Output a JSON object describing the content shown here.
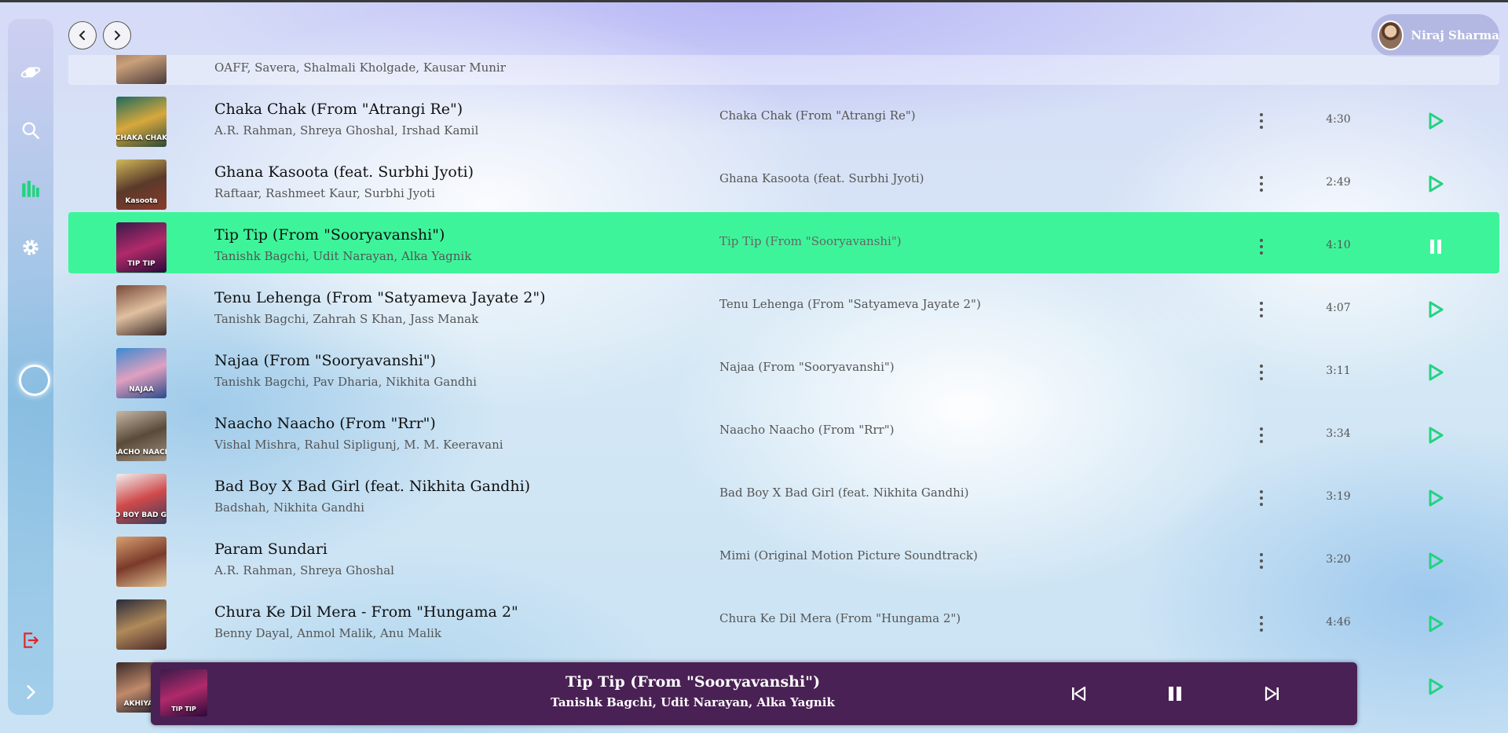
{
  "user": {
    "name": "Niraj Sharma"
  },
  "colors": {
    "accent": "#3ef49a",
    "player_bg": "#4a2154",
    "play_icon": "#22d37f",
    "logout_icon": "#e02424"
  },
  "sidebar": {
    "items": [
      {
        "icon": "planet-icon"
      },
      {
        "icon": "search-icon"
      },
      {
        "icon": "library-icon",
        "active": true
      },
      {
        "icon": "settings-icon"
      },
      {
        "icon": "logout-icon"
      },
      {
        "icon": "chevron-right-icon"
      }
    ]
  },
  "songs": [
    {
      "title": "",
      "artists": "OAFF, Savera, Shalmali Kholgade, Kausar Munir",
      "album": "",
      "duration": "",
      "cover_text": ""
    },
    {
      "title": "Chaka Chak (From \"Atrangi Re\")",
      "artists": "A.R. Rahman, Shreya Ghoshal, Irshad Kamil",
      "album": "Chaka Chak (From \"Atrangi Re\")",
      "duration": "4:30",
      "cover_text": "CHAKA CHAK"
    },
    {
      "title": "Ghana Kasoota (feat. Surbhi Jyoti)",
      "artists": "Raftaar, Rashmeet Kaur, Surbhi Jyoti",
      "album": "Ghana Kasoota (feat. Surbhi Jyoti)",
      "duration": "2:49",
      "cover_text": "Kasoota"
    },
    {
      "title": "Tip Tip (From \"Sooryavanshi\")",
      "artists": "Tanishk Bagchi, Udit Narayan, Alka Yagnik",
      "album": "Tip Tip (From \"Sooryavanshi\")",
      "duration": "4:10",
      "cover_text": "TIP TIP",
      "playing": true
    },
    {
      "title": "Tenu Lehenga (From \"Satyameva Jayate 2\")",
      "artists": "Tanishk Bagchi, Zahrah S Khan, Jass Manak",
      "album": "Tenu Lehenga (From \"Satyameva Jayate 2\")",
      "duration": "4:07",
      "cover_text": ""
    },
    {
      "title": "Najaa (From \"Sooryavanshi\")",
      "artists": "Tanishk Bagchi, Pav Dharia, Nikhita Gandhi",
      "album": "Najaa (From \"Sooryavanshi\")",
      "duration": "3:11",
      "cover_text": "NAJAA"
    },
    {
      "title": "Naacho Naacho (From \"Rrr\")",
      "artists": "Vishal Mishra, Rahul Sipligunj, M. M. Keeravani",
      "album": "Naacho Naacho (From \"Rrr\")",
      "duration": "3:34",
      "cover_text": "NAACHO NAACHO"
    },
    {
      "title": "Bad Boy X Bad Girl (feat. Nikhita Gandhi)",
      "artists": "Badshah, Nikhita Gandhi",
      "album": "Bad Boy X Bad Girl (feat. Nikhita Gandhi)",
      "duration": "3:19",
      "cover_text": "BAD BOY BAD GIRL"
    },
    {
      "title": "Param Sundari",
      "artists": "A.R. Rahman, Shreya Ghoshal",
      "album": "Mimi (Original Motion Picture Soundtrack)",
      "duration": "3:20",
      "cover_text": ""
    },
    {
      "title": "Chura Ke Dil Mera - From \"Hungama 2\"",
      "artists": "Benny Dayal, Anmol Malik, Anu Malik",
      "album": "Chura Ke Dil Mera (From \"Hungama 2\")",
      "duration": "4:46",
      "cover_text": ""
    },
    {
      "title": "",
      "artists": "",
      "album": "",
      "duration": "",
      "cover_text": "AKHIYAN"
    }
  ],
  "player": {
    "title": "Tip Tip (From \"Sooryavanshi\")",
    "artists": "Tanishk Bagchi, Udit Narayan, Alka Yagnik",
    "cover_text": "TIP TIP"
  }
}
